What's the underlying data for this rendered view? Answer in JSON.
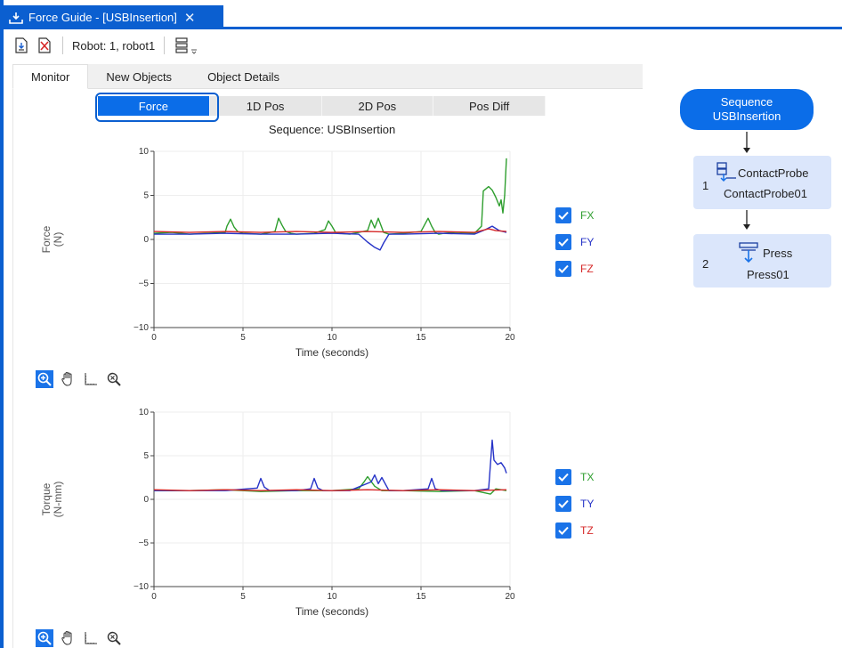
{
  "window": {
    "tab_title": "Force Guide - [USBInsertion]",
    "accent": "#0b5fd0"
  },
  "toolbar": {
    "robot_label": "Robot: 1, robot1"
  },
  "view_tabs": [
    {
      "label": "Monitor",
      "active": true
    },
    {
      "label": "New Objects",
      "active": false
    },
    {
      "label": "Object Details",
      "active": false
    }
  ],
  "segments": [
    {
      "label": "Force",
      "active": true
    },
    {
      "label": "1D Pos",
      "active": false
    },
    {
      "label": "2D Pos",
      "active": false
    },
    {
      "label": "Pos Diff",
      "active": false
    }
  ],
  "chart_data": [
    {
      "type": "line",
      "title": "Sequence: USBInsertion",
      "xlabel": "Time (seconds)",
      "ylabel": "Force\n(N)",
      "xlim": [
        0,
        20
      ],
      "ylim": [
        -10,
        10
      ],
      "xticks": [
        "0",
        "5",
        "10",
        "15",
        "20"
      ],
      "yticks": [
        "10",
        "5",
        "0",
        "−5",
        "−10"
      ],
      "series": [
        {
          "name": "FX",
          "color": "#2e9e2e",
          "x": [
            0,
            1,
            2,
            3,
            4,
            4.1,
            4.3,
            4.5,
            4.7,
            5,
            6,
            6.8,
            7.0,
            7.2,
            7.4,
            7.7,
            8,
            9,
            9.6,
            9.8,
            10.0,
            10.2,
            10.4,
            11,
            12,
            12.2,
            12.4,
            12.6,
            12.9,
            13.2,
            14,
            15,
            15.4,
            15.6,
            15.8,
            16.0,
            16.3,
            17,
            18,
            18.4,
            18.5,
            18.8,
            19.0,
            19.2,
            19.4,
            19.5,
            19.6,
            19.7,
            19.8
          ],
          "y": [
            0.7,
            0.8,
            0.6,
            0.7,
            0.8,
            1.5,
            2.3,
            1.4,
            0.9,
            0.7,
            0.6,
            0.9,
            2.4,
            1.6,
            0.9,
            0.7,
            0.6,
            0.7,
            1.1,
            2.1,
            1.5,
            0.8,
            0.7,
            0.6,
            1.0,
            2.2,
            1.3,
            2.4,
            0.8,
            0.6,
            0.7,
            0.9,
            2.4,
            1.5,
            0.8,
            0.6,
            0.7,
            0.8,
            0.7,
            1.5,
            5.5,
            6.0,
            5.6,
            4.8,
            3.8,
            4.5,
            3.0,
            5.0,
            9.2
          ]
        },
        {
          "name": "FY",
          "color": "#2633c7",
          "x": [
            0,
            2,
            4,
            6,
            8,
            10,
            11.5,
            12.0,
            12.4,
            12.7,
            12.9,
            13.2,
            14,
            16,
            18,
            18.6,
            19.0,
            19.4,
            19.8
          ],
          "y": [
            0.6,
            0.6,
            0.7,
            0.6,
            0.6,
            0.7,
            0.6,
            -0.3,
            -0.9,
            -1.2,
            -0.4,
            0.6,
            0.6,
            0.7,
            0.6,
            1.1,
            1.5,
            1.0,
            0.8
          ]
        },
        {
          "name": "FZ",
          "color": "#d62828",
          "x": [
            0,
            2,
            4,
            6,
            8,
            10,
            12,
            14,
            16,
            18,
            18.8,
            19.2,
            19.8
          ],
          "y": [
            0.9,
            0.8,
            0.9,
            0.8,
            0.9,
            0.8,
            0.9,
            0.8,
            0.9,
            0.8,
            1.2,
            1.0,
            0.9
          ]
        }
      ]
    },
    {
      "type": "line",
      "title": "",
      "xlabel": "Time (seconds)",
      "ylabel": "Torque\n(N-mm)",
      "xlim": [
        0,
        20
      ],
      "ylim": [
        -10,
        10
      ],
      "xticks": [
        "0",
        "5",
        "10",
        "15",
        "20"
      ],
      "yticks": [
        "10",
        "5",
        "0",
        "−5",
        "−10"
      ],
      "series": [
        {
          "name": "TX",
          "color": "#2e9e2e",
          "x": [
            0,
            2,
            4,
            6,
            8,
            10,
            11.5,
            11.8,
            12.0,
            12.4,
            12.8,
            14,
            16,
            18,
            18.9,
            19.2,
            19.8
          ],
          "y": [
            1.0,
            1.0,
            1.1,
            0.9,
            1.0,
            1.0,
            1.2,
            2.0,
            2.6,
            1.5,
            1.0,
            1.0,
            0.9,
            1.0,
            0.6,
            1.2,
            1.0
          ]
        },
        {
          "name": "TY",
          "color": "#2633c7",
          "x": [
            0,
            2,
            4,
            5.8,
            6.0,
            6.2,
            6.5,
            8,
            8.8,
            9.0,
            9.2,
            9.5,
            11,
            12.2,
            12.4,
            12.6,
            12.8,
            13.2,
            14,
            15.4,
            15.6,
            15.8,
            16.2,
            18,
            18.8,
            19.0,
            19.1,
            19.3,
            19.5,
            19.7,
            19.8
          ],
          "y": [
            1.0,
            1.0,
            1.0,
            1.3,
            2.4,
            1.4,
            1.0,
            1.0,
            1.2,
            2.4,
            1.3,
            1.0,
            1.0,
            2.0,
            2.8,
            1.8,
            2.5,
            1.0,
            1.0,
            1.2,
            2.4,
            1.2,
            1.0,
            1.0,
            1.2,
            6.8,
            4.5,
            4.0,
            4.2,
            3.6,
            3.0
          ]
        },
        {
          "name": "TZ",
          "color": "#d62828",
          "x": [
            0,
            2,
            4,
            6,
            8,
            10,
            12,
            14,
            16,
            18,
            19.8
          ],
          "y": [
            1.1,
            1.0,
            1.1,
            1.0,
            1.1,
            1.0,
            1.1,
            1.0,
            1.1,
            1.0,
            1.1
          ]
        }
      ]
    }
  ],
  "legend_force": [
    {
      "label": "FX",
      "color": "#2e9e2e"
    },
    {
      "label": "FY",
      "color": "#2633c7"
    },
    {
      "label": "FZ",
      "color": "#d62828"
    }
  ],
  "legend_torque": [
    {
      "label": "TX",
      "color": "#2e9e2e"
    },
    {
      "label": "TY",
      "color": "#2633c7"
    },
    {
      "label": "TZ",
      "color": "#d62828"
    }
  ],
  "flow": {
    "sequence_line1": "Sequence",
    "sequence_line2": "USBInsertion",
    "steps": [
      {
        "index": "1",
        "type": "ContactProbe",
        "name": "ContactProbe01"
      },
      {
        "index": "2",
        "type": "Press",
        "name": "Press01"
      }
    ]
  }
}
